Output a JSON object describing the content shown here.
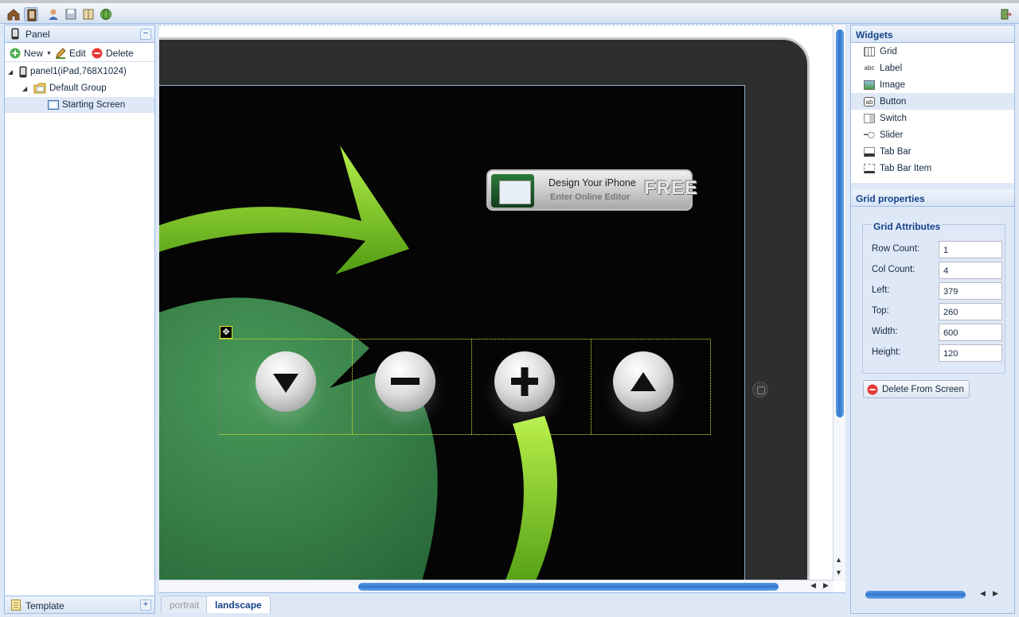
{
  "toolbar": {
    "icons": [
      "home-icon",
      "panel-icon",
      "user-icon",
      "save-icon",
      "book-icon",
      "globe-icon"
    ],
    "exit_icon": "exit-icon"
  },
  "left_panel": {
    "title": "Panel",
    "actions": {
      "new": "New",
      "edit": "Edit",
      "delete": "Delete"
    },
    "tree": {
      "root": "panel1(iPad,768X1024)",
      "group": "Default Group",
      "screen": "Starting Screen"
    },
    "footer_title": "Template"
  },
  "canvas": {
    "banner": {
      "line1": "Design Your iPhone",
      "line2": "Enter Online Editor",
      "badge": "FREE"
    },
    "grid_buttons": [
      "arrow-down-icon",
      "minus-icon",
      "plus-icon",
      "arrow-up-icon"
    ]
  },
  "orientation_tabs": {
    "portrait": "portrait",
    "landscape": "landscape",
    "active": "landscape"
  },
  "widgets": {
    "title": "Widgets",
    "items": [
      {
        "label": "Grid",
        "icon": "grid-icon"
      },
      {
        "label": "Label",
        "icon": "label-icon",
        "icon_text": "abc"
      },
      {
        "label": "Image",
        "icon": "image-icon"
      },
      {
        "label": "Button",
        "icon": "button-icon",
        "icon_text": "ab",
        "selected": true
      },
      {
        "label": "Switch",
        "icon": "switch-icon"
      },
      {
        "label": "Slider",
        "icon": "slider-icon"
      },
      {
        "label": "Tab Bar",
        "icon": "tab-bar-icon"
      },
      {
        "label": "Tab Bar Item",
        "icon": "tab-bar-item-icon"
      }
    ]
  },
  "grid_properties": {
    "title": "Grid properties",
    "section": "Grid Attributes",
    "fields": [
      {
        "label": "Row Count:",
        "value": "1"
      },
      {
        "label": "Col Count:",
        "value": "4"
      },
      {
        "label": "Left:",
        "value": "379"
      },
      {
        "label": "Top:",
        "value": "260"
      },
      {
        "label": "Width:",
        "value": "600"
      },
      {
        "label": "Height:",
        "value": "120"
      }
    ],
    "delete_button": "Delete From Screen"
  },
  "colors": {
    "accent": "#15428b",
    "panel_bg": "#dfe8f6",
    "border": "#99bbe8",
    "scroll_thumb": "#2f76d0"
  }
}
